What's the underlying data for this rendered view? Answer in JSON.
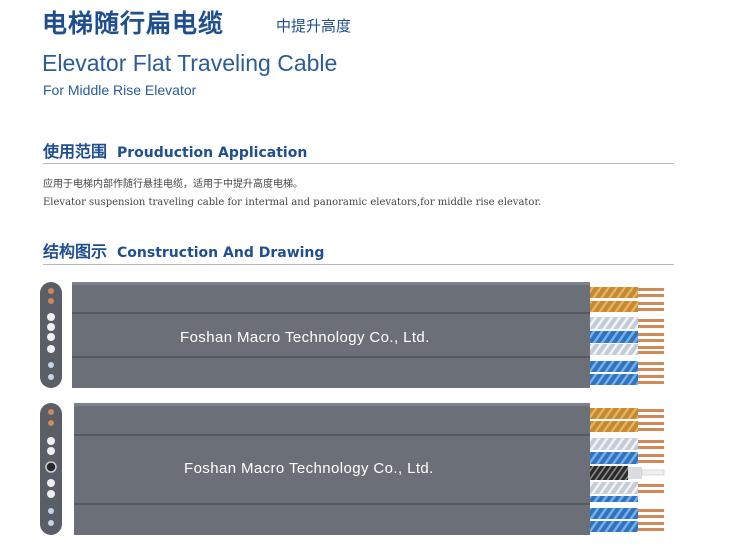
{
  "header": {
    "title_cn": "电梯随行扁电缆",
    "title_cn_sub": "中提升高度",
    "title_en": "Elevator Flat Traveling Cable",
    "subtitle_en": "For Middle Rise Elevator"
  },
  "application": {
    "heading_cn": "使用范围",
    "heading_en": "Prouduction Application",
    "text_cn": "应用于电梯内部作随行悬挂电缆，适用于中提升高度电梯。",
    "text_en": "Elevator suspension traveling cable for intermal and panoramic elevators,for middle rise elevator."
  },
  "construction": {
    "heading_cn": "结构图示",
    "heading_en": "Construction And Drawing"
  },
  "cables": [
    {
      "watermark": "Foshan Macro Technology Co., Ltd."
    },
    {
      "watermark": "Foshan Macro Technology Co., Ltd."
    }
  ],
  "colors": {
    "brand_blue": "#1f4f8f",
    "jacket_gray": "#6b6f77",
    "copper": "#d08a5a",
    "wire_blue": "#2f74c0",
    "wire_orange": "#c8882e"
  }
}
